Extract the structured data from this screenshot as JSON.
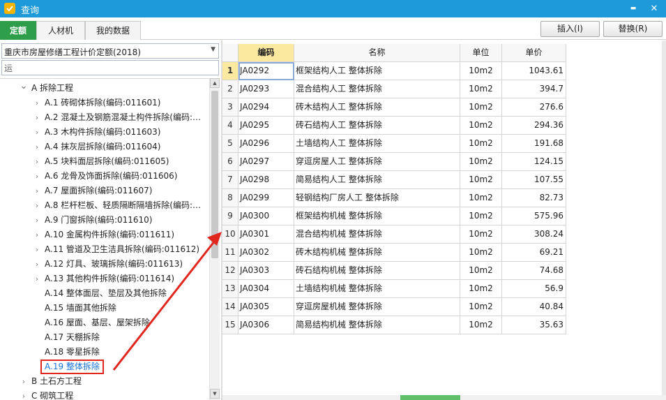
{
  "window": {
    "title": "查询",
    "minimize_glyph": "▬",
    "close_glyph": "✕"
  },
  "tabs": [
    {
      "label": "定额"
    },
    {
      "label": "人材机"
    },
    {
      "label": "我的数据"
    }
  ],
  "toolbar": {
    "insert_label": "插入(I)",
    "replace_label": "替换(R)"
  },
  "left_panel": {
    "quota_library": "重庆市房屋修缮工程计价定额(2018)",
    "search_value": "运",
    "tree": [
      {
        "label": "A 拆除工程",
        "expanded": true
      },
      {
        "label": "A.1 砖砌体拆除(编码:011601)"
      },
      {
        "label": "A.2 混凝土及钢筋混凝土构件拆除(编码:…"
      },
      {
        "label": "A.3 木构件拆除(编码:011603)"
      },
      {
        "label": "A.4 抹灰层拆除(编码:011604)"
      },
      {
        "label": "A.5 块料面层拆除(编码:011605)"
      },
      {
        "label": "A.6 龙骨及饰面拆除(编码:011606)"
      },
      {
        "label": "A.7 屋面拆除(编码:011607)"
      },
      {
        "label": "A.8 栏杆栏板、轻质隔断隔墙拆除(编码:…"
      },
      {
        "label": "A.9 门窗拆除(编码:011610)"
      },
      {
        "label": "A.10 金属构件拆除(编码:011611)"
      },
      {
        "label": "A.11 管道及卫生洁具拆除(编码:011612)"
      },
      {
        "label": "A.12 灯具、玻璃拆除(编码:011613)"
      },
      {
        "label": "A.13 其他构件拆除(编码:011614)"
      },
      {
        "label": "A.14 整体面层、垫层及其他拆除"
      },
      {
        "label": "A.15 墙面其他拆除"
      },
      {
        "label": "A.16 屋面、基层、屋架拆除"
      },
      {
        "label": "A.17 天棚拆除"
      },
      {
        "label": "A.18 零星拆除"
      },
      {
        "label": "A.19 整体拆除",
        "selected": true
      },
      {
        "label": "B 土石方工程"
      },
      {
        "label": "C 砌筑工程"
      }
    ]
  },
  "grid": {
    "headers": {
      "code": "编码",
      "name": "名称",
      "unit": "单位",
      "price": "单价"
    },
    "current_row": 1,
    "rows": [
      {
        "num": "1",
        "code": "JA0292",
        "name": "框架结构人工 整体拆除",
        "unit": "10m2",
        "price": "1043.61"
      },
      {
        "num": "2",
        "code": "JA0293",
        "name": "混合结构人工 整体拆除",
        "unit": "10m2",
        "price": "394.7"
      },
      {
        "num": "3",
        "code": "JA0294",
        "name": "砖木结构人工 整体拆除",
        "unit": "10m2",
        "price": "276.6"
      },
      {
        "num": "4",
        "code": "JA0295",
        "name": "砖石结构人工 整体拆除",
        "unit": "10m2",
        "price": "294.36"
      },
      {
        "num": "5",
        "code": "JA0296",
        "name": "土墙结构人工 整体拆除",
        "unit": "10m2",
        "price": "191.68"
      },
      {
        "num": "6",
        "code": "JA0297",
        "name": "穿逗房屋人工 整体拆除",
        "unit": "10m2",
        "price": "124.15"
      },
      {
        "num": "7",
        "code": "JA0298",
        "name": "简易结构人工 整体拆除",
        "unit": "10m2",
        "price": "107.55"
      },
      {
        "num": "8",
        "code": "JA0299",
        "name": "轻钢结构厂房人工 整体拆除",
        "unit": "10m2",
        "price": "82.73"
      },
      {
        "num": "9",
        "code": "JA0300",
        "name": "框架结构机械 整体拆除",
        "unit": "10m2",
        "price": "575.96"
      },
      {
        "num": "10",
        "code": "JA0301",
        "name": "混合结构机械 整体拆除",
        "unit": "10m2",
        "price": "308.24"
      },
      {
        "num": "11",
        "code": "JA0302",
        "name": "砖木结构机械 整体拆除",
        "unit": "10m2",
        "price": "69.21"
      },
      {
        "num": "12",
        "code": "JA0303",
        "name": "砖石结构机械 整体拆除",
        "unit": "10m2",
        "price": "74.68"
      },
      {
        "num": "13",
        "code": "JA0304",
        "name": "土墙结构机械 整体拆除",
        "unit": "10m2",
        "price": "56.9"
      },
      {
        "num": "14",
        "code": "JA0305",
        "name": "穿逗房屋机械 整体拆除",
        "unit": "10m2",
        "price": "40.84"
      },
      {
        "num": "15",
        "code": "JA0306",
        "name": "简易结构机械 整体拆除",
        "unit": "10m2",
        "price": "35.63"
      }
    ]
  },
  "colors": {
    "titlebar": "#1e9ad8",
    "active_tab": "#2e9e4a",
    "header_highlight": "#fbe9a0",
    "annotation_red": "#e0261d",
    "selected_text": "#1a73d9"
  }
}
